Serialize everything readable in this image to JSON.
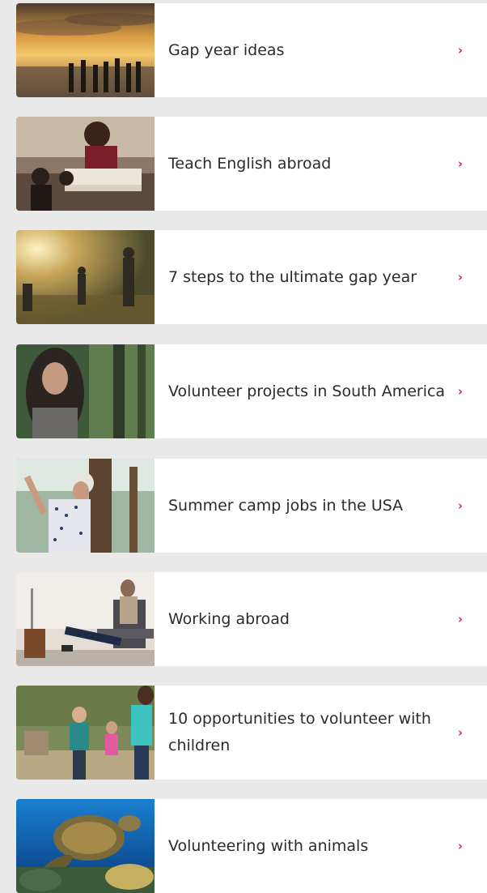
{
  "accent": "#d81b7c",
  "chevron_icon": "chevron-right-icon",
  "items": [
    {
      "label": "Gap year ideas",
      "photo": "sunset-surfers-photo"
    },
    {
      "label": "Teach English abroad",
      "photo": "classroom-photo"
    },
    {
      "label": "7 steps to the ultimate gap year",
      "photo": "hikers-photo"
    },
    {
      "label": "Volunteer projects in South America",
      "photo": "forest-woman-photo"
    },
    {
      "label": "Summer camp jobs in the USA",
      "photo": "tree-climbing-photo"
    },
    {
      "label": "Working abroad",
      "photo": "airport-lounge-photo"
    },
    {
      "label": "10 opportunities to volunteer with children",
      "photo": "children-running-photo"
    },
    {
      "label": "Volunteering with animals",
      "photo": "sea-turtle-photo"
    }
  ]
}
